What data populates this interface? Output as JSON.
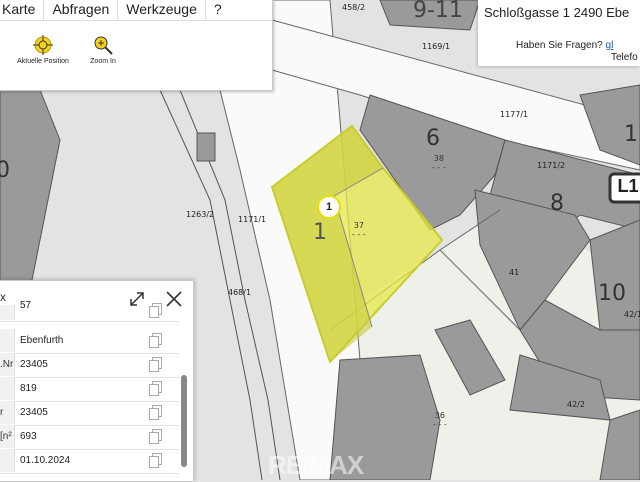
{
  "menu": {
    "items": [
      "Karte",
      "Abfragen",
      "Werkzeuge",
      "?"
    ]
  },
  "tools": [
    {
      "label": "Aktuelle Position",
      "icon": "crosshair-icon"
    },
    {
      "label": "Zoom In",
      "icon": "zoom-in-icon"
    }
  ],
  "address": {
    "text": "Schloßgasse 1 2490 Ebe",
    "question": "Haben Sie Fragen?",
    "link": "gl",
    "phone": "Telefo"
  },
  "map": {
    "parcel_labels": [
      "458/2",
      "1169/1",
      "1177/1",
      "1171/2",
      "1263/2",
      "1171/1",
      "468/1",
      "41",
      "42/2",
      "42/1"
    ],
    "house_numbers": [
      "9-11",
      "6",
      "8",
      "1",
      "10",
      "0",
      "1"
    ],
    "address_labels": [
      "38",
      "37",
      "36"
    ],
    "marker": "1",
    "badge": "L1",
    "watermark": "RE/MAX",
    "colors": {
      "highlight": "#e5e84a",
      "highlight_dark": "#c8cc2a",
      "building": "#9a9a9a",
      "road": "#f8f8f8"
    }
  },
  "panel": {
    "x_label": "x",
    "rows": [
      {
        "key": "",
        "value": "57"
      },
      {
        "key": "",
        "value": "Ebenfurth"
      },
      {
        "key": "Nr.",
        "value": "23405"
      },
      {
        "key": "",
        "value": "819"
      },
      {
        "key": "r",
        "value": "23405"
      },
      {
        "key": "n²]",
        "value": "693"
      },
      {
        "key": "",
        "value": "01.10.2024"
      }
    ]
  }
}
